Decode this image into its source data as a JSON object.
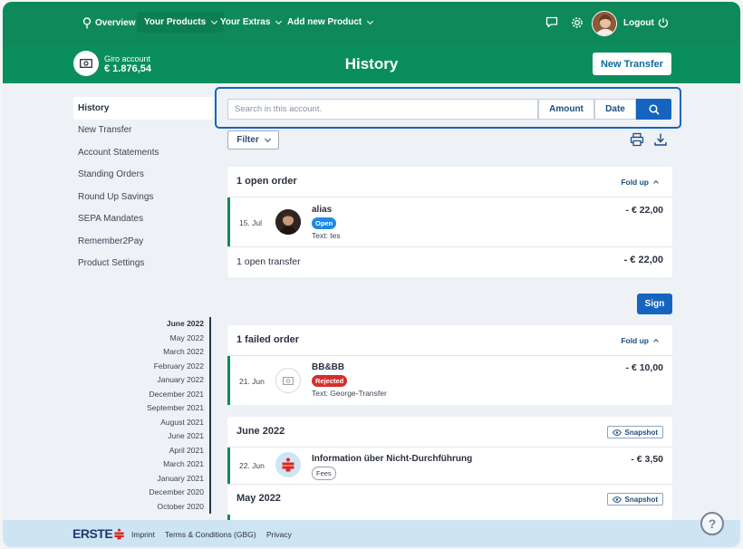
{
  "topnav": {
    "overview": "Overview",
    "your_products": "Your Products",
    "your_extras": "Your Extras",
    "add_new_product": "Add new Product",
    "logout": "Logout"
  },
  "account": {
    "name": "Giro account",
    "balance": "€ 1.876,54"
  },
  "page": {
    "title": "History",
    "new_transfer": "New Transfer"
  },
  "sidebar": {
    "items": [
      {
        "label": "History"
      },
      {
        "label": "New Transfer"
      },
      {
        "label": "Account Statements"
      },
      {
        "label": "Standing Orders"
      },
      {
        "label": "Round Up Savings"
      },
      {
        "label": "SEPA Mandates"
      },
      {
        "label": "Remember2Pay"
      },
      {
        "label": "Product Settings"
      }
    ]
  },
  "months": [
    "June 2022",
    "May 2022",
    "March 2022",
    "February 2022",
    "January 2022",
    "December 2021",
    "September 2021",
    "August 2021",
    "June 2021",
    "April 2021",
    "March 2021",
    "January 2021",
    "December 2020",
    "October 2020"
  ],
  "search": {
    "placeholder": "Search in this account.",
    "amount": "Amount",
    "date": "Date"
  },
  "filter": {
    "label": "Filter"
  },
  "open_orders": {
    "title": "1 open order",
    "fold": "Fold up",
    "row": {
      "date": "15. Jul",
      "name": "alias",
      "badge": "Open",
      "text": "Text: tes",
      "amount": "- € 22,00"
    },
    "summary_label": "1 open transfer",
    "summary_amount": "- € 22,00"
  },
  "sign": {
    "label": "Sign"
  },
  "failed_orders": {
    "title": "1 failed order",
    "fold": "Fold up",
    "row": {
      "date": "21. Jun",
      "name": "BB&BB",
      "badge": "Rejected",
      "text": "Text: George-Transfer",
      "amount": "- € 10,00"
    }
  },
  "june_2022": {
    "title": "June 2022",
    "snapshot": "Snapshot",
    "row": {
      "date": "22. Jun",
      "name": "Information über Nicht-Durchführung",
      "badge": "Fees",
      "amount": "- € 3,50"
    }
  },
  "may_2022": {
    "title": "May 2022",
    "snapshot": "Snapshot"
  },
  "footer": {
    "brand": "ERSTE",
    "imprint": "Imprint",
    "terms": "Terms & Conditions (GBG)",
    "privacy": "Privacy"
  },
  "help": {
    "label": "?"
  },
  "colors": {
    "primary_green": "#0e8a5a",
    "accent_blue": "#1565c0",
    "rejected_red": "#d32f2f",
    "open_blue": "#1e88e5"
  }
}
